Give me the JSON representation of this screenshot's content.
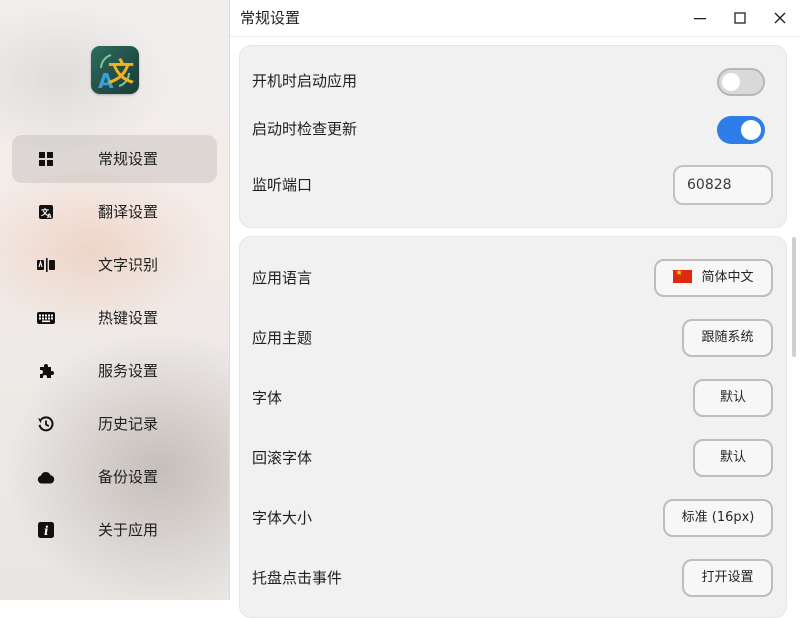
{
  "window": {
    "title": "常规设置",
    "controls": [
      "minimize",
      "maximize",
      "close"
    ]
  },
  "sidebar": {
    "logo_icon": "translate-logo-icon",
    "items": [
      {
        "label": "常规设置",
        "icon": "grid-icon",
        "active": true
      },
      {
        "label": "翻译设置",
        "icon": "translate-icon",
        "active": false
      },
      {
        "label": "文字识别",
        "icon": "ocr-icon",
        "active": false
      },
      {
        "label": "热键设置",
        "icon": "keyboard-icon",
        "active": false
      },
      {
        "label": "服务设置",
        "icon": "puzzle-icon",
        "active": false
      },
      {
        "label": "历史记录",
        "icon": "history-icon",
        "active": false
      },
      {
        "label": "备份设置",
        "icon": "cloud-icon",
        "active": false
      },
      {
        "label": "关于应用",
        "icon": "info-icon",
        "active": false
      }
    ]
  },
  "settings": {
    "startup_label": "开机时启动应用",
    "startup_enabled": false,
    "check_update_label": "启动时检查更新",
    "check_update_enabled": true,
    "port_label": "监听端口",
    "port_value": "60828",
    "language_label": "应用语言",
    "language_value": "简体中文",
    "theme_label": "应用主题",
    "theme_value": "跟随系统",
    "font_label": "字体",
    "font_value": "默认",
    "fallback_font_label": "回滚字体",
    "fallback_font_value": "默认",
    "font_size_label": "字体大小",
    "font_size_value": "标准 (16px)",
    "tray_click_label": "托盘点击事件",
    "tray_click_value": "打开设置"
  },
  "colors": {
    "accent": "#2f7de8",
    "logo_bg": "#234f49",
    "logo_text": "#f2b21b",
    "logo_a": "#3aa0d8"
  }
}
